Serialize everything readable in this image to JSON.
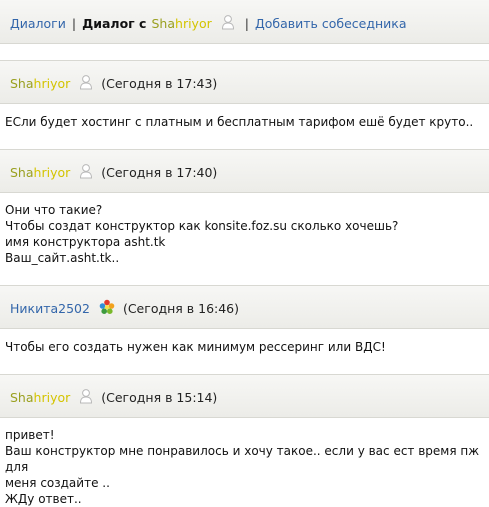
{
  "topbar": {
    "dialogs_label": "Диалоги",
    "separator": "|",
    "dialog_with_label": "Диалог с",
    "partner_name_part1": "Sha",
    "partner_name_part2": "hriyor",
    "add_label": "Добавить собеседника"
  },
  "messages": [
    {
      "author_part1": "Sha",
      "author_part2": "hriyor",
      "time": "(Сегодня в 17:43)",
      "lines": [
        "ЕСли будет хостинг с платным и бесплатным тарифом ешё будет круто.."
      ]
    },
    {
      "author_part1": "Sha",
      "author_part2": "hriyor",
      "time": "(Сегодня в 17:40)",
      "lines": [
        "Они что такие?",
        "Чтобы создат конструктор как konsite.foz.su сколько хочешь?",
        "имя конструктора asht.tk",
        "Ваш_сайт.asht.tk.."
      ]
    },
    {
      "author": "Никита2502",
      "time": "(Сегодня в 16:46)",
      "lines": [
        "Чтобы его создать нужен как минимум рессеринг или ВДС!"
      ]
    },
    {
      "author_part1": "Sha",
      "author_part2": "hriyor",
      "time": "(Сегодня в 15:14)",
      "lines": [
        "привет!",
        "Ваш конструктор мне понравилось и хочу такое.. если у вас ест время пж для",
        "меня создайте ..",
        "ЖДу ответ.."
      ]
    }
  ]
}
